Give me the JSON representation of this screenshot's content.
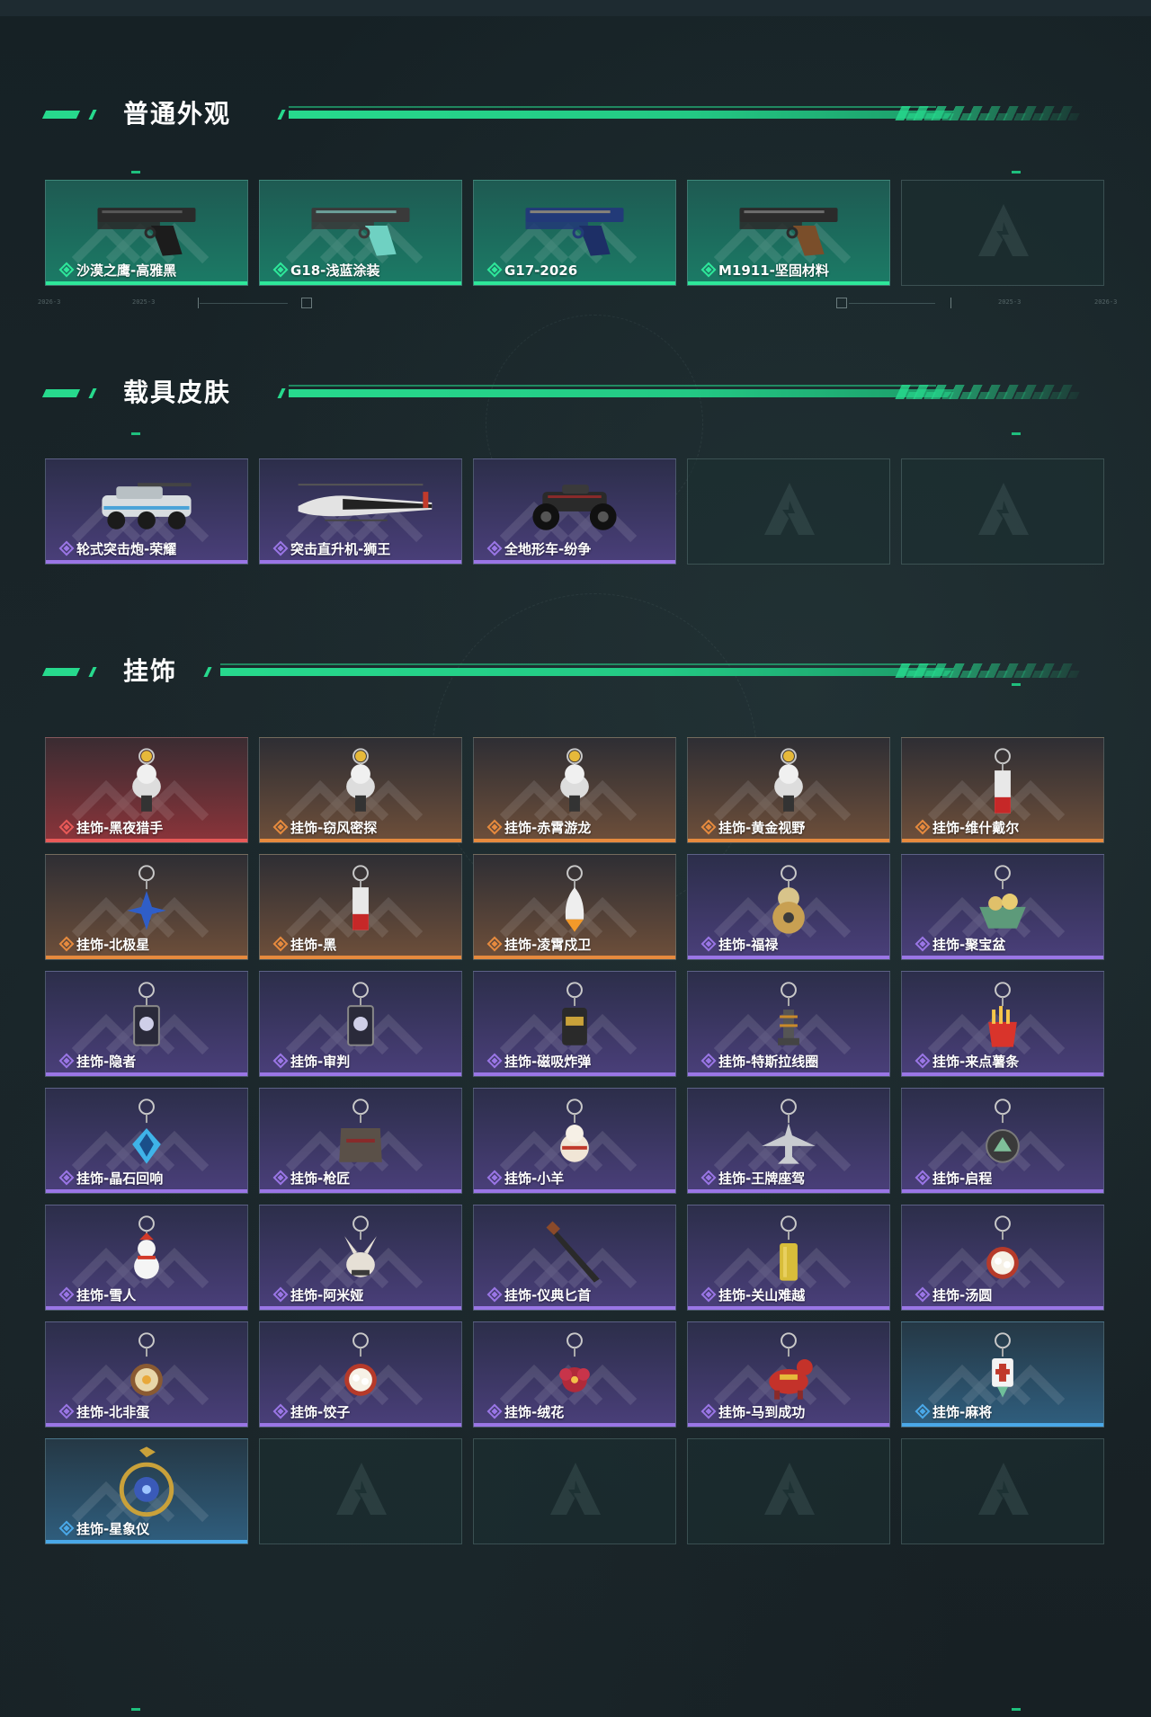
{
  "sections": {
    "normal_skins": {
      "title": "普通外观",
      "items": [
        {
          "label": "沙漠之鹰-高雅黑",
          "rarity": "green",
          "icon": "pistol-desert-eagle-black"
        },
        {
          "label": "G18-浅蓝涂装",
          "rarity": "green",
          "icon": "pistol-g18-light-blue"
        },
        {
          "label": "G17-2026",
          "rarity": "green",
          "icon": "pistol-g17-navy"
        },
        {
          "label": "M1911-坚固材料",
          "rarity": "green",
          "icon": "pistol-m1911-wood-grip"
        }
      ]
    },
    "vehicle_skins": {
      "title": "载具皮肤",
      "items": [
        {
          "label": "轮式突击炮-荣耀",
          "rarity": "purple",
          "icon": "vehicle-wheeled-assault-gun"
        },
        {
          "label": "突击直升机-狮王",
          "rarity": "purple",
          "icon": "vehicle-attack-helicopter"
        },
        {
          "label": "全地形车-纷争",
          "rarity": "purple",
          "icon": "vehicle-atv"
        }
      ]
    },
    "charms": {
      "title": "挂饰",
      "items": [
        {
          "label": "挂饰-黑夜猎手",
          "rarity": "red",
          "icon": "charm-figure"
        },
        {
          "label": "挂饰-窃风密探",
          "rarity": "orange",
          "icon": "charm-figure"
        },
        {
          "label": "挂饰-赤霄游龙",
          "rarity": "orange",
          "icon": "charm-figure"
        },
        {
          "label": "挂饰-黄金视野",
          "rarity": "orange",
          "icon": "charm-figure"
        },
        {
          "label": "挂饰-维什戴尔",
          "rarity": "orange",
          "icon": "charm-tag"
        },
        {
          "label": "挂饰-北极星",
          "rarity": "orange",
          "icon": "charm-star"
        },
        {
          "label": "挂饰-黑",
          "rarity": "orange",
          "icon": "charm-tag"
        },
        {
          "label": "挂饰-凌霄戍卫",
          "rarity": "orange",
          "icon": "charm-rocket"
        },
        {
          "label": "挂饰-福禄",
          "rarity": "purple",
          "icon": "charm-gourd"
        },
        {
          "label": "挂饰-聚宝盆",
          "rarity": "purple",
          "icon": "charm-treasure-bowl"
        },
        {
          "label": "挂饰-隐者",
          "rarity": "purple",
          "icon": "charm-card"
        },
        {
          "label": "挂饰-审判",
          "rarity": "purple",
          "icon": "charm-card"
        },
        {
          "label": "挂饰-磁吸炸弹",
          "rarity": "purple",
          "icon": "charm-bomb"
        },
        {
          "label": "挂饰-特斯拉线圈",
          "rarity": "purple",
          "icon": "charm-coil"
        },
        {
          "label": "挂饰-来点薯条",
          "rarity": "purple",
          "icon": "charm-fries"
        },
        {
          "label": "挂饰-晶石回响",
          "rarity": "purple",
          "icon": "charm-crystal"
        },
        {
          "label": "挂饰-枪匠",
          "rarity": "purple",
          "icon": "charm-vest"
        },
        {
          "label": "挂饰-小羊",
          "rarity": "purple",
          "icon": "charm-sheep"
        },
        {
          "label": "挂饰-王牌座驾",
          "rarity": "purple",
          "icon": "charm-jet"
        },
        {
          "label": "挂饰-启程",
          "rarity": "purple",
          "icon": "charm-medal"
        },
        {
          "label": "挂饰-雪人",
          "rarity": "purple",
          "icon": "charm-snowman"
        },
        {
          "label": "挂饰-阿米娅",
          "rarity": "purple",
          "icon": "charm-rabbit"
        },
        {
          "label": "挂饰-仪典匕首",
          "rarity": "purple",
          "icon": "charm-dagger"
        },
        {
          "label": "挂饰-关山难越",
          "rarity": "purple",
          "icon": "charm-gold-bar"
        },
        {
          "label": "挂饰-汤圆",
          "rarity": "purple",
          "icon": "charm-bowl"
        },
        {
          "label": "挂饰-北非蛋",
          "rarity": "purple",
          "icon": "charm-pan"
        },
        {
          "label": "挂饰-饺子",
          "rarity": "purple",
          "icon": "charm-bowl"
        },
        {
          "label": "挂饰-绒花",
          "rarity": "purple",
          "icon": "charm-flower"
        },
        {
          "label": "挂饰-马到成功",
          "rarity": "purple",
          "icon": "charm-horse"
        },
        {
          "label": "挂饰-麻将",
          "rarity": "blue",
          "icon": "charm-mahjong-tile"
        },
        {
          "label": "挂饰-星象仪",
          "rarity": "blue",
          "icon": "charm-astrolabe"
        }
      ]
    }
  },
  "colors": {
    "accent": "#27d98d",
    "green": "#2ee89a",
    "purple": "#9a76e6",
    "red": "#e85a58",
    "orange": "#e68a3e",
    "blue": "#4aa8e8"
  },
  "divider_labels": [
    "2026-3",
    "2025-3",
    "2025-3",
    "2026-3"
  ]
}
